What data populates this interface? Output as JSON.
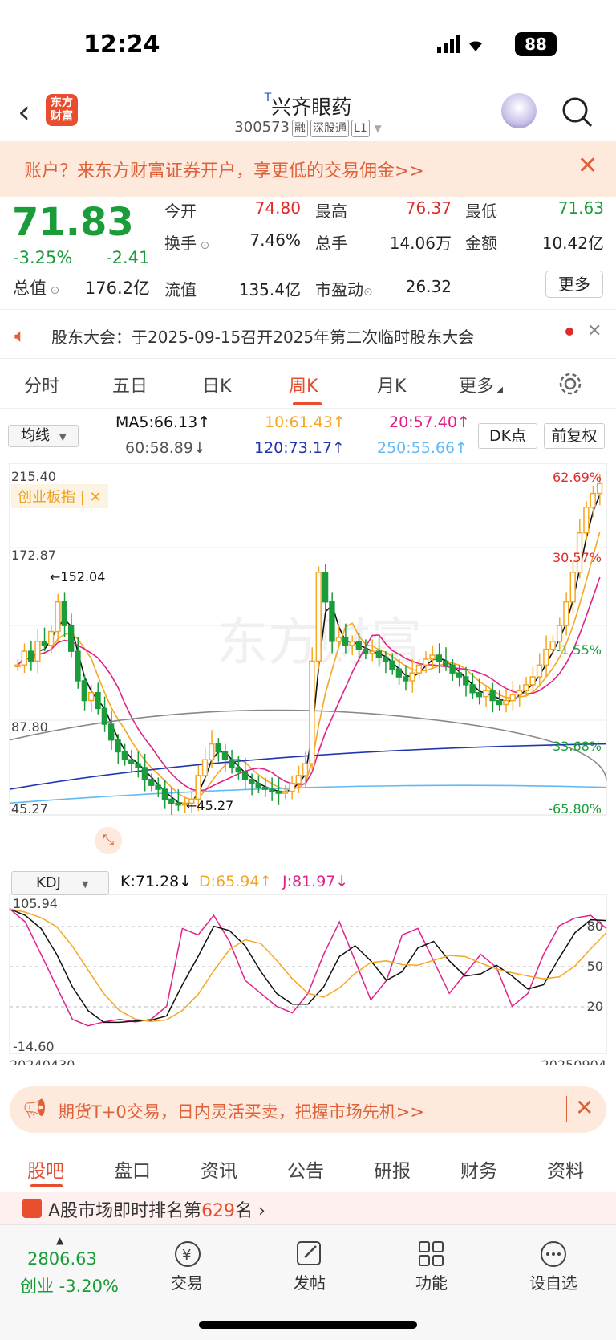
{
  "status": {
    "time": "12:24",
    "battery": "88"
  },
  "header": {
    "title": "兴齐眼药",
    "title_mark": "T",
    "code": "300573",
    "tags": [
      "融",
      "深股通",
      "L1"
    ],
    "logo": "东方\n财富"
  },
  "promo": {
    "text": "账户？来东方财富证券开户，享更低的交易佣金>>"
  },
  "quote": {
    "price": "71.83",
    "pct": "-3.25%",
    "change": "-2.41",
    "total_value_label": "总值",
    "total_value": "176.2亿",
    "fields": [
      {
        "label": "今开",
        "value": "74.80",
        "color": "#e02a2a"
      },
      {
        "label": "最高",
        "value": "76.37",
        "color": "#e02a2a"
      },
      {
        "label": "最低",
        "value": "71.63",
        "color": "#1a9c3a"
      },
      {
        "label": "换手",
        "value": "7.46%",
        "color": "#222"
      },
      {
        "label": "总手",
        "value": "14.06万",
        "color": "#222"
      },
      {
        "label": "金额",
        "value": "10.42亿",
        "color": "#222"
      },
      {
        "label": "流值",
        "value": "135.4亿",
        "color": "#222"
      },
      {
        "label": "市盈动",
        "value": "26.32",
        "color": "#222"
      }
    ],
    "more": "更多"
  },
  "notice": {
    "text": "股东大会：于2025-09-15召开2025年第二次临时股东大会"
  },
  "tabs": [
    "分时",
    "五日",
    "日K",
    "周K",
    "月K",
    "更多"
  ],
  "ma": {
    "selector": "均线",
    "ma5": "MA5:66.13↑",
    "ma10": "10:61.43↑",
    "ma20": "20:57.40↑",
    "ma60": "60:58.89↓",
    "ma120": "120:73.17↑",
    "ma250": "250:55.66↑",
    "dk": "DK点",
    "fq": "前复权"
  },
  "chart_data": {
    "type": "candlestick",
    "ylim": [
      45.27,
      215.4
    ],
    "y_labels": [
      "215.40",
      "172.87",
      "87.80",
      "45.27"
    ],
    "right_labels": [
      "62.69%",
      "30.57%",
      "-1.55%",
      "-33.68%",
      "-65.80%"
    ],
    "annotations": {
      "high": "152.04",
      "low": "45.27",
      "index": "创业板指"
    },
    "x_start": "20240430",
    "x_end": "20250904",
    "kdj": {
      "label": "KDJ",
      "k": "K:71.28↓",
      "d": "D:65.94↑",
      "j": "J:81.97↓",
      "top": "105.94",
      "bottom": "-14.60",
      "levels": [
        "80",
        "50",
        "20"
      ]
    }
  },
  "watermark": "东方财富",
  "futures": {
    "text": "期货T+0交易，日内灵活买卖，把握市场先机>>"
  },
  "bottom_tabs": [
    "股吧",
    "盘口",
    "资讯",
    "公告",
    "研报",
    "财务",
    "资料"
  ],
  "rank": {
    "text": "A股市场即时排名第",
    "num": "629",
    "suffix": "名"
  },
  "nav": {
    "index_value": "2806.63",
    "index_label": "创业 -3.20%",
    "items": [
      "交易",
      "发帖",
      "功能",
      "设自选"
    ]
  }
}
